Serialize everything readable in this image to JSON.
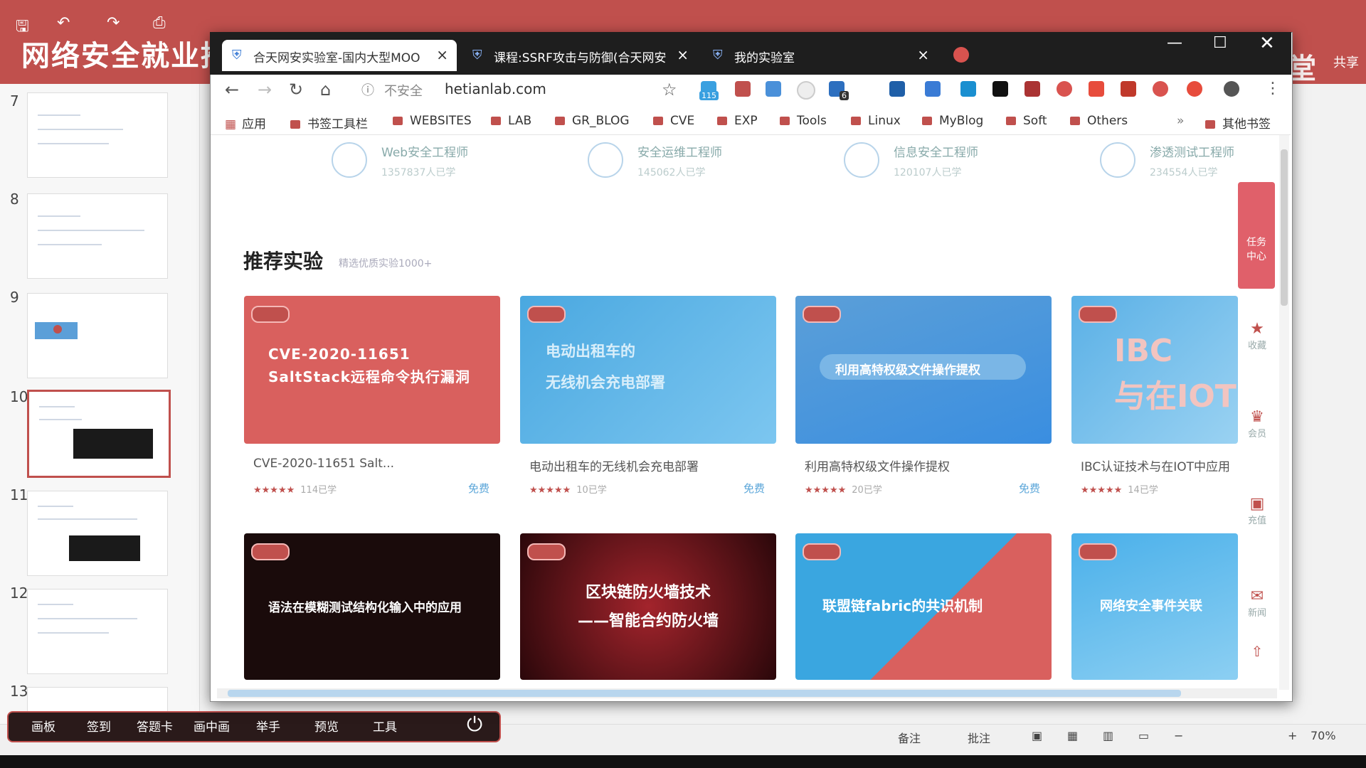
{
  "ppt": {
    "title": "网络安全就业推荐",
    "brand": "腾讯课堂",
    "share": "共享",
    "slides": [
      {
        "num": "7"
      },
      {
        "num": "8"
      },
      {
        "num": "9"
      },
      {
        "num": "10"
      },
      {
        "num": "11"
      },
      {
        "num": "12"
      },
      {
        "num": "13"
      }
    ],
    "status": {
      "notes": "备注",
      "comments": "批注",
      "zoom": "70%"
    }
  },
  "float_toolbar": {
    "items": [
      "画板",
      "签到",
      "答题卡",
      "画中画",
      "举手",
      "预览",
      "工具"
    ]
  },
  "browser": {
    "tabs": [
      {
        "label": "合天网安实验室-国内大型MOO",
        "active": true
      },
      {
        "label": "课程:SSRF攻击与防御(合天网安",
        "active": false
      },
      {
        "label": "我的实验室",
        "active": false
      }
    ],
    "address": {
      "insecure": "不安全",
      "url": "hetianlab.com"
    },
    "ext_badges": {
      "a": "115",
      "b": "6"
    },
    "bookmarks": [
      "应用",
      "书签工具栏",
      "WEBSITES",
      "LAB",
      "GR_BLOG",
      "CVE",
      "EXP",
      "Tools",
      "Linux",
      "MyBlog",
      "Soft",
      "Others",
      "»",
      "其他书签"
    ]
  },
  "page": {
    "careers": [
      {
        "title": "Web安全工程师",
        "learners": "1357837人已学"
      },
      {
        "title": "安全运维工程师",
        "learners": "145062人已学"
      },
      {
        "title": "信息安全工程师",
        "learners": "120107人已学"
      },
      {
        "title": "渗透测试工程师",
        "learners": "234554人已学"
      }
    ],
    "section_title": "推荐实验",
    "section_sub": "精选优质实验1000+",
    "cards_row1": [
      {
        "img_text": "CVE-2020-11651\nSaltStack远程命令执行漏洞",
        "name": "CVE-2020-11651 Salt...",
        "learners": "114已学",
        "price": "免费",
        "color": "#d9605e"
      },
      {
        "img_text": "电动出租车的\n无线机会充电部署",
        "name": "电动出租车的无线机会充电部署",
        "learners": "10已学",
        "price": "免费",
        "color": "#4aa8e0"
      },
      {
        "img_text": "利用高特权级文件操作提权",
        "name": "利用高特权级文件操作提权",
        "learners": "20已学",
        "price": "免费",
        "color": "#5b9fd8"
      },
      {
        "img_text": "IBC\n与在IOT中应",
        "name": "IBC认证技术与在IOT中应用",
        "learners": "14已学",
        "price": "",
        "color": "#5ab0e6"
      }
    ],
    "cards_row2": [
      {
        "img_text": "语法在模糊测试结构化输入中的应用",
        "color": "#1a0b0b"
      },
      {
        "img_text": "区块链防火墙技术\n——智能合约防火墙",
        "color": "#3a0a0e"
      },
      {
        "img_text": "联盟链fabric的共识机制",
        "color": "#3aa6e0"
      },
      {
        "img_text": "网络安全事件关联",
        "color": "#4ab0ea"
      }
    ],
    "side": {
      "task_center": "任务中心",
      "items": [
        "收藏",
        "会员",
        "充值",
        "新闻"
      ]
    }
  }
}
